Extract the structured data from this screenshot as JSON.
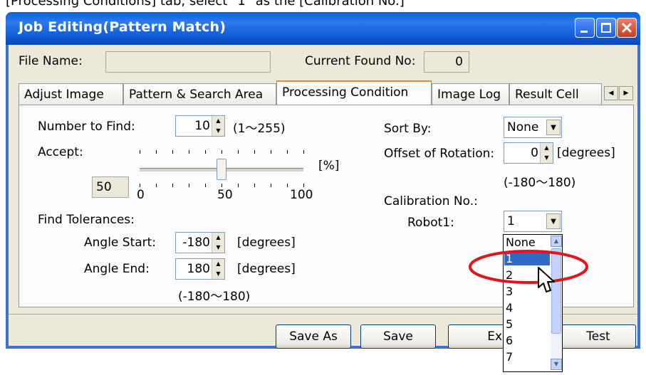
{
  "caption": "[Processing Conditions] tab, select \"1\" as the [Calibration No.]",
  "window": {
    "title": "Job Editing(Pattern Match)"
  },
  "header": {
    "file_name_label": "File Name:",
    "file_name_value": "",
    "found_no_label": "Current Found No:",
    "found_no_value": "0"
  },
  "tabs": [
    {
      "label": "Adjust Image"
    },
    {
      "label": "Pattern & Search Area"
    },
    {
      "label": "Processing Condition"
    },
    {
      "label": "Image Log"
    },
    {
      "label": "Result Cell"
    }
  ],
  "form": {
    "number_to_find_label": "Number to Find:",
    "number_to_find_value": "10",
    "number_to_find_range": "(1～255)",
    "accept_label": "Accept:",
    "accept_value": "50",
    "accept_slider_level": 0.5,
    "percent_unit": "[%]",
    "slider_min": "0",
    "slider_mid": "50",
    "slider_max": "100",
    "find_tolerances_label": "Find Tolerances:",
    "angle_start_label": "Angle Start:",
    "angle_start_value": "-180",
    "angle_end_label": "Angle End:",
    "angle_end_value": "180",
    "degrees_unit": "[degrees]",
    "angle_range": "(-180～180)",
    "sort_by_label": "Sort By:",
    "sort_by_value": "None",
    "offset_rotation_label": "Offset of Rotation:",
    "offset_rotation_value": "0",
    "offset_range": "(-180～180)",
    "calibration_label": "Calibration No.:",
    "robot_label": "Robot1:",
    "robot_value": "1",
    "dropdown_options": [
      "None",
      "1",
      "2",
      "3",
      "4",
      "5",
      "6",
      "7"
    ],
    "dropdown_selected": "1"
  },
  "buttons": {
    "save_as": "Save As",
    "save": "Save",
    "exit": "Exi",
    "test": "Test"
  },
  "colors": {
    "highlight_circle": "#e3141c",
    "selection": "#316ac5",
    "title_bar": "#0a5fd8"
  }
}
